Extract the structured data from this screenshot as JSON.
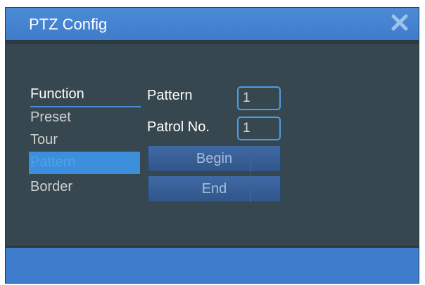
{
  "window": {
    "title": "PTZ Config",
    "close_icon": "close-icon",
    "colors": {
      "titlebar": "#3f7ccb",
      "panel": "#36474f",
      "accent": "#4c9ee6"
    }
  },
  "sidebar": {
    "header": "Function",
    "items": [
      {
        "label": "Preset",
        "active": false
      },
      {
        "label": "Tour",
        "active": false
      },
      {
        "label": "Pattern",
        "active": true
      },
      {
        "label": "Border",
        "active": false
      }
    ]
  },
  "form": {
    "pattern": {
      "label": "Pattern",
      "value": "1"
    },
    "patrol": {
      "label": "Patrol No.",
      "value": "1"
    }
  },
  "buttons": {
    "begin": "Begin",
    "end": "End"
  }
}
